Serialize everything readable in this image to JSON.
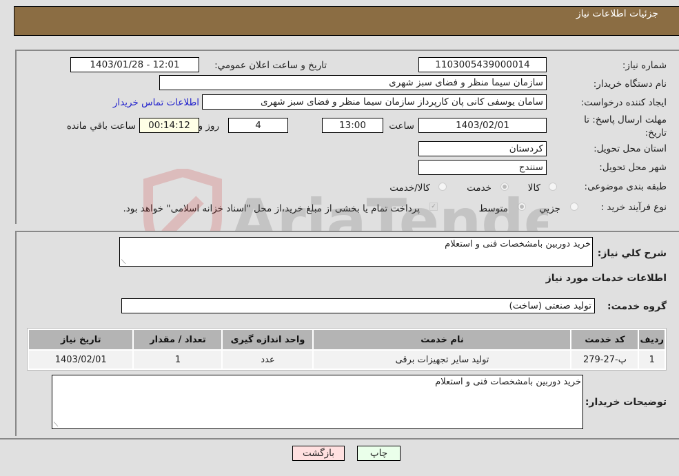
{
  "header": {
    "title": "جزئيات اطلاعات نياز"
  },
  "form": {
    "need_number": {
      "label": "شماره نياز:",
      "value": "1103005439000014"
    },
    "announce_datetime": {
      "label": "تاريخ و ساعت اعلان عمومي:",
      "value": "1403/01/28 - 12:01"
    },
    "buyer_org": {
      "label": "نام دستگاه خريدار:",
      "value": "سازمان سيما  منظر و فضای سبز شهری"
    },
    "requester": {
      "label": "ايجاد کننده درخواست:",
      "value": "سامان یوسفی کانی پان کارپرداز سازمان سیما  منظر و فضای سبز شهری"
    },
    "buyer_contact_link": "اطلاعات تماس خريدار",
    "deadline": {
      "label": "مهلت ارسال پاسخ: تا تاريخ:",
      "date": "1403/02/01",
      "time_label": "ساعت",
      "time": "13:00",
      "days": "4",
      "days_label": "روز و",
      "remaining": "00:14:12",
      "remaining_label": "ساعت باقي مانده"
    },
    "province": {
      "label": "استان محل تحويل:",
      "value": "کردستان"
    },
    "city": {
      "label": "شهر محل تحويل:",
      "value": "سنندج"
    },
    "category": {
      "label": "طبقه بندی موضوعی:",
      "options": [
        "کالا",
        "خدمت",
        "کالا/خدمت"
      ],
      "selected": "خدمت"
    },
    "purchase_type": {
      "label": "نوع فرآيند خريد :",
      "options": [
        "جزيي",
        "متوسط"
      ],
      "selected": "متوسط",
      "treasury_note": "پرداخت تمام يا بخشی از مبلغ خريد،از محل \"اسناد خزانه اسلامی\" خواهد بود.",
      "treasury_checked": true
    }
  },
  "details": {
    "summary_label": "شرح کلي نياز:",
    "summary_value": "خريد دوربين بامشخصات فنی و استعلام",
    "services_heading": "اطلاعات خدمات مورد نياز",
    "service_group_label": "گروه خدمت:",
    "service_group_value": "توليد صنعتی (ساخت)",
    "table": {
      "headers": [
        "رديف",
        "کد خدمت",
        "نام خدمت",
        "واحد اندازه گيری",
        "تعداد / مقدار",
        "تاريخ نياز"
      ],
      "rows": [
        [
          "1",
          "پ-27-279",
          "توليد ساير تجهيزات برقی",
          "عدد",
          "1",
          "1403/02/01"
        ]
      ]
    },
    "buyer_notes_label": "توضيحات خريدار:",
    "buyer_notes_value": "خريد دوربين بامشخصات فنی و استعلام"
  },
  "buttons": {
    "print": "چاپ",
    "back": "بازگشت"
  },
  "watermark": "AriaTender.net"
}
